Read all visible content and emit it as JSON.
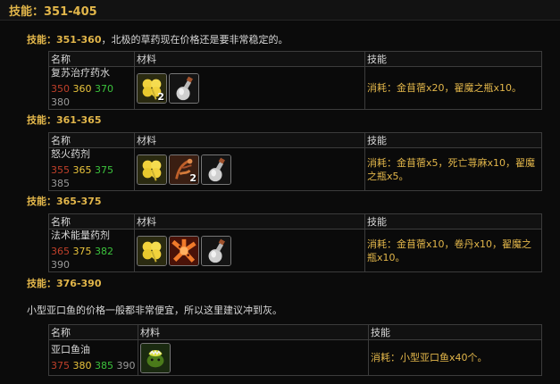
{
  "page": {
    "title": "技能：351-405"
  },
  "headers": {
    "name": "名称",
    "materials": "材料",
    "skill": "技能"
  },
  "sections": [
    {
      "label": "技能：",
      "range": "351-360",
      "note": "，北极的草药现在价格还是要非常稳定的。",
      "recipe": {
        "name": "复苏治疗药水",
        "levels": [
          "350",
          "360",
          "370",
          "380"
        ],
        "materials": [
          {
            "icon": "clover-herb-icon",
            "count": "2"
          },
          {
            "icon": "vial-icon",
            "count": ""
          }
        ],
        "cost": "消耗：金苜蓿x20，翟魔之瓶x10。"
      }
    },
    {
      "label": "技能：",
      "range": "361-365",
      "note": "",
      "recipe": {
        "name": "怒火药剂",
        "levels": [
          "355",
          "365",
          "375",
          "385"
        ],
        "materials": [
          {
            "icon": "clover-herb-icon",
            "count": ""
          },
          {
            "icon": "deathnettle-herb-icon",
            "count": "2"
          },
          {
            "icon": "vial-icon",
            "count": ""
          }
        ],
        "cost": "消耗：金苜蓿x5，死亡荨麻x10，翟魔之瓶x5。"
      }
    },
    {
      "label": "技能：",
      "range": "365-375",
      "note": "",
      "recipe": {
        "name": "法术能量药剂",
        "levels": [
          "365",
          "375",
          "382",
          "390"
        ],
        "materials": [
          {
            "icon": "clover-herb-icon",
            "count": ""
          },
          {
            "icon": "tiger-lily-herb-icon",
            "count": ""
          },
          {
            "icon": "vial-icon",
            "count": ""
          }
        ],
        "cost": "消耗：金苜蓿x10，卷丹x10，翟魔之瓶x10。"
      }
    },
    {
      "label": "技能：",
      "range": "376-390",
      "note": "",
      "paragraph": "小型亚口鱼的价格一般都非常便宜，所以这里建议冲到灰。",
      "recipe": {
        "name": "亚口鱼油",
        "levels": [
          "375",
          "380",
          "385",
          "390"
        ],
        "materials": [
          {
            "icon": "sucker-fish-icon",
            "count": ""
          }
        ],
        "cost": "消耗：小型亚口鱼x40个。"
      }
    }
  ]
}
